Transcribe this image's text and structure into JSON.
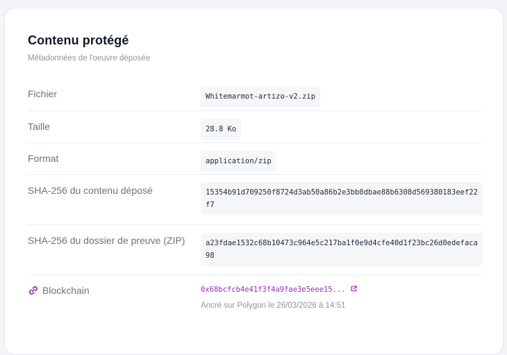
{
  "card": {
    "title": "Contenu protégé",
    "subtitle": "Métadonnées de l'oeuvre déposée"
  },
  "rows": [
    {
      "label": "Fichier",
      "value": "Whitemarmot-artizo-v2.zip"
    },
    {
      "label": "Taille",
      "value": "28.8 Ko"
    },
    {
      "label": "Format",
      "value": "application/zip"
    },
    {
      "label": "SHA-256 du contenu déposé",
      "value": "15354b91d709250f8724d3ab50a86b2e3bb0dbae88b6308d569380183eef22f7"
    },
    {
      "label": "SHA-256 du dossier de preuve (ZIP)",
      "value": "a23fdae1532c68b10473c964e5c217ba1f0e9d4cfe40d1f23bc26d0edefaca98"
    }
  ],
  "blockchain": {
    "label": "Blockchain",
    "tx": "0x68bcfcb4e41f3f4a9fae3e5eee15...",
    "anchored": "Ancré sur Polygon le 26/03/2026 à 14:51",
    "icon": "chain-link-icon",
    "accent": "#9b2bbd"
  }
}
